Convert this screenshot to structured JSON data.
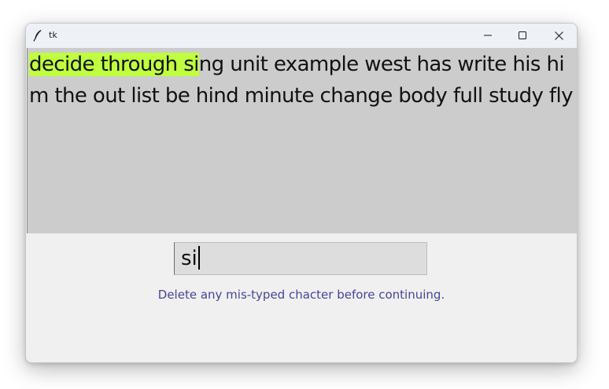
{
  "window": {
    "title": "tk",
    "controls": {
      "minimize_icon": "minimize-icon",
      "maximize_icon": "maximize-icon",
      "close_icon": "close-icon"
    }
  },
  "passage": {
    "highlighted": "decide through si",
    "remaining": "ng unit example west has write his him the out list be hind minute change body full study fly",
    "highlight_color": "#bfff3f",
    "background_color": "#cccccc"
  },
  "input": {
    "value": "si"
  },
  "status": {
    "message": "Delete any mis-typed chacter before continuing.",
    "color": "#45459a"
  }
}
